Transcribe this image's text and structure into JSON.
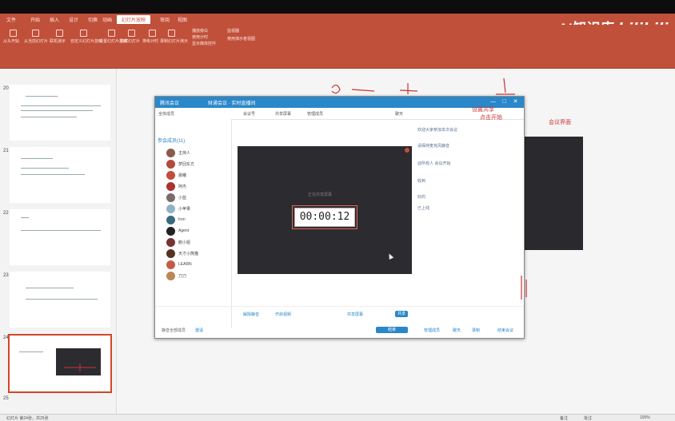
{
  "app": {
    "file_tab": "文件",
    "tabs": [
      "开始",
      "插入",
      "设计",
      "切换",
      "动画",
      "幻灯片放映",
      "审阅",
      "视图"
    ],
    "active_tab": "幻灯片放映",
    "brand": "AI知识库",
    "brand_logo": "bilibili",
    "colors": {
      "ribbon": "#c0503a",
      "meeting": "#2a87c9"
    }
  },
  "ribbon": {
    "groups": [
      "从头开始",
      "从当前幻灯片",
      "联机演示",
      "自定义幻灯片放映",
      "设置幻灯片放映",
      "隐藏幻灯片",
      "排练计时",
      "录制幻灯片演示",
      "播放旁白",
      "使用计时",
      "显示媒体控件",
      "监视器",
      "使用演示者视图"
    ]
  },
  "thumbnails": {
    "numbers": [
      "20",
      "21",
      "22",
      "23",
      "24",
      "25"
    ],
    "selected": "24"
  },
  "meeting": {
    "title": "腾讯会议",
    "room_title": "财通会议 · 实时直播间",
    "window_buttons": [
      "—",
      "□",
      "✕"
    ],
    "toolbar": [
      "全体成员",
      "会议号",
      "共享屏幕",
      "管理成员",
      "聊天"
    ],
    "members_header": "参会成员(11)",
    "members": [
      "主持人",
      "梦回东方",
      "晨曦",
      "阿杰",
      "小蓝",
      "小苹果",
      "Iron",
      "Agent",
      "鹅小姐",
      "天才小熊猫",
      "LEARN",
      "刀刀"
    ],
    "camera_label": "正在共享屏幕",
    "timer": "00:00:12",
    "chat_lines": [
      "欢迎大家参加本次会议",
      "请保持麦克风静音",
      "@所有人 会议开始",
      "收到",
      "好的",
      "已上线"
    ],
    "bottom": [
      "解除静音",
      "开启视频",
      "共享屏幕",
      "邀请",
      "管理成员",
      "聊天",
      "录制",
      "结束会议"
    ],
    "bottom_left_label": "静音全部成员",
    "primary_button": "共享",
    "end_button": "结束"
  },
  "annotations": [
    "设置共享",
    "点击开始",
    "会议界面"
  ],
  "statusbar": {
    "left": "幻灯片 第24张，共25张",
    "right": [
      "备注",
      "批注",
      "100%"
    ]
  }
}
